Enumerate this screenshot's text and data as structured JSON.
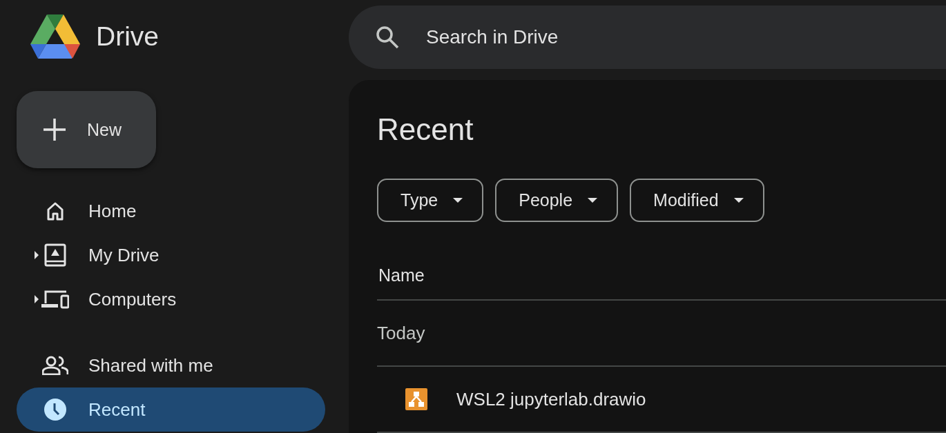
{
  "app": {
    "title": "Drive"
  },
  "new_button": {
    "label": "New"
  },
  "sidebar": {
    "sections": [
      [
        {
          "label": "Home",
          "expandable": false,
          "selected": false
        },
        {
          "label": "My Drive",
          "expandable": true,
          "selected": false
        },
        {
          "label": "Computers",
          "expandable": true,
          "selected": false
        }
      ],
      [
        {
          "label": "Shared with me",
          "expandable": false,
          "selected": false
        },
        {
          "label": "Recent",
          "expandable": false,
          "selected": true
        }
      ]
    ]
  },
  "search": {
    "placeholder": "Search in Drive"
  },
  "page": {
    "title": "Recent"
  },
  "filters": [
    {
      "label": "Type"
    },
    {
      "label": "People"
    },
    {
      "label": "Modified"
    }
  ],
  "table": {
    "columns": [
      "Name"
    ],
    "groups": [
      {
        "label": "Today",
        "rows": [
          {
            "name": "WSL2 jupyterlab.drawio"
          }
        ]
      }
    ]
  }
}
